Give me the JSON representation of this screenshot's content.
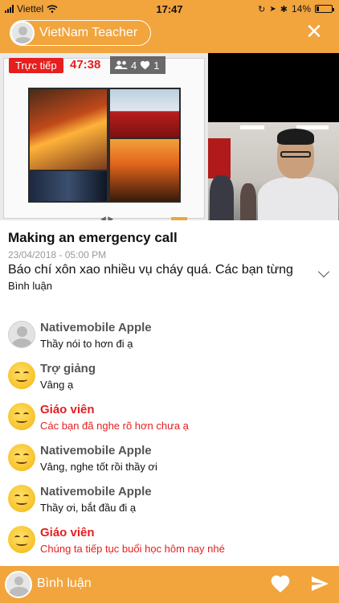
{
  "status_bar": {
    "carrier": "Viettel",
    "time": "17:47",
    "battery": "14%",
    "battery_level": 0.14
  },
  "header": {
    "teacher_name": "VietNam Teacher",
    "close_icon": "close-icon"
  },
  "video": {
    "live_label": "Trực tiếp",
    "elapsed": "47:38",
    "viewer_count": "4",
    "like_count": "1"
  },
  "lesson": {
    "title": "Making an emergency call",
    "datetime": "23/04/2018 - 05:00 PM",
    "description": "Báo chí xôn xao nhiều vụ cháy quá. Các bạn từng",
    "comments_label": "Bình luận"
  },
  "comments": [
    {
      "name": "Nativemobile Apple",
      "text": "Thầy nói to hơn đi ạ",
      "role": "user"
    },
    {
      "name": "Trợ giảng",
      "text": "Vâng ạ",
      "role": "assistant"
    },
    {
      "name": "Giáo viên",
      "text": "Các bạn đã nghe rõ hơn chưa ạ",
      "role": "teacher"
    },
    {
      "name": "Nativemobile Apple",
      "text": "Vâng, nghe tốt rồi thầy ơi",
      "role": "user"
    },
    {
      "name": "Nativemobile Apple",
      "text": "Thầy ơi, bắt đầu đi ạ",
      "role": "user"
    },
    {
      "name": "Giáo viên",
      "text": "Chúng ta tiếp tục buổi học hôm nay nhé",
      "role": "teacher"
    }
  ],
  "composer": {
    "placeholder": "Bình luận"
  },
  "colors": {
    "brand": "#f2a43d",
    "live": "#e61e1e",
    "teacher_text": "#e61e1e"
  }
}
